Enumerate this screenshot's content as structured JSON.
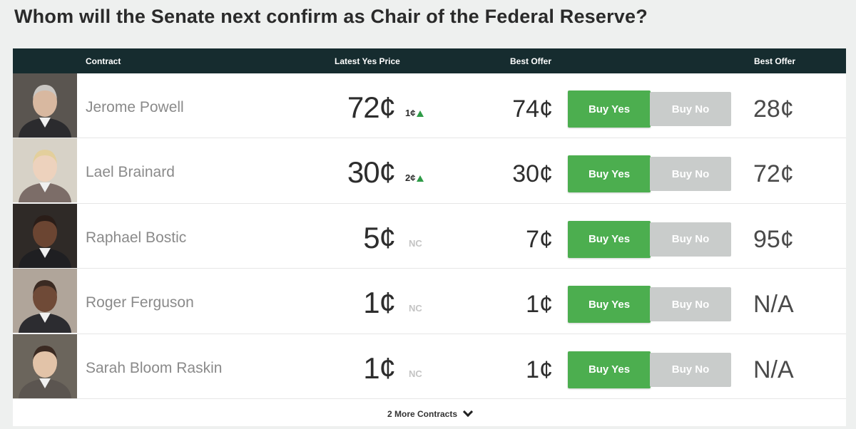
{
  "page": {
    "title": "Whom will the Senate next confirm as Chair of the Federal Reserve?"
  },
  "table": {
    "headers": {
      "contract": "Contract",
      "latest_yes_price": "Latest Yes Price",
      "best_offer_yes": "Best Offer",
      "best_offer_no": "Best Offer"
    },
    "rows": [
      {
        "name": "Jerome Powell",
        "yes_price": "72¢",
        "change": "1¢",
        "change_direction": "up",
        "best_offer_yes": "74¢",
        "buy_yes": "Buy Yes",
        "buy_no": "Buy No",
        "best_offer_no": "28¢",
        "avatar": {
          "bg": "#5a5550",
          "skin": "#d8b8a0",
          "hair": "#c9c6c2",
          "suit": "#2b2b2e"
        }
      },
      {
        "name": "Lael Brainard",
        "yes_price": "30¢",
        "change": "2¢",
        "change_direction": "up",
        "best_offer_yes": "30¢",
        "buy_yes": "Buy Yes",
        "buy_no": "Buy No",
        "best_offer_no": "72¢",
        "avatar": {
          "bg": "#d7d2c7",
          "skin": "#edd2bd",
          "hair": "#e3cf9c",
          "suit": "#7c6d68"
        }
      },
      {
        "name": "Raphael Bostic",
        "yes_price": "5¢",
        "change": "NC",
        "change_direction": "none",
        "best_offer_yes": "7¢",
        "buy_yes": "Buy Yes",
        "buy_no": "Buy No",
        "best_offer_no": "95¢",
        "avatar": {
          "bg": "#2f2a27",
          "skin": "#6b4532",
          "hair": "#2a1d18",
          "suit": "#1f1f22"
        }
      },
      {
        "name": "Roger Ferguson",
        "yes_price": "1¢",
        "change": "NC",
        "change_direction": "none",
        "best_offer_yes": "1¢",
        "buy_yes": "Buy Yes",
        "buy_no": "Buy No",
        "best_offer_no": "N/A",
        "avatar": {
          "bg": "#b0a59a",
          "skin": "#6f4a37",
          "hair": "#3a2a22",
          "suit": "#2c2c30"
        }
      },
      {
        "name": "Sarah Bloom Raskin",
        "yes_price": "1¢",
        "change": "NC",
        "change_direction": "none",
        "best_offer_yes": "1¢",
        "buy_yes": "Buy Yes",
        "buy_no": "Buy No",
        "best_offer_no": "N/A",
        "avatar": {
          "bg": "#6b655c",
          "skin": "#e2c3a8",
          "hair": "#3b2a22",
          "suit": "#5b5550"
        }
      }
    ],
    "more_contracts": "2 More Contracts"
  },
  "colors": {
    "header_bg": "#162c2f",
    "buy_yes": "#4cae4f",
    "buy_no": "#c9cccb",
    "up_arrow": "#2e9b47"
  }
}
